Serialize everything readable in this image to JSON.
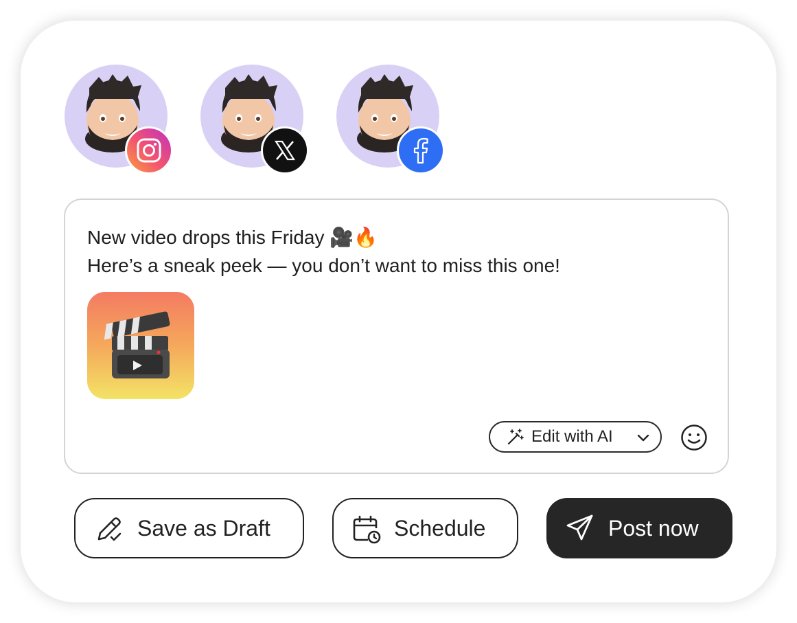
{
  "accounts": [
    {
      "platform": "Instagram",
      "badge_icon": "instagram-icon"
    },
    {
      "platform": "X",
      "badge_icon": "x-icon"
    },
    {
      "platform": "Facebook",
      "badge_icon": "facebook-icon"
    }
  ],
  "composer": {
    "line1": "New video drops this Friday 🎥🔥",
    "line2": "Here’s a sneak peek — you don’t want to miss this one!",
    "attachment_icon": "clapperboard-icon",
    "ai_button_label": "Edit with AI",
    "emoji_icon": "smiley-icon"
  },
  "actions": {
    "draft_label": "Save as Draft",
    "schedule_label": "Schedule",
    "post_label": "Post now"
  },
  "colors": {
    "avatar_bg": "#d9d0f5",
    "facebook": "#2e6ef5",
    "x": "#111111",
    "primary_button": "#262626"
  }
}
